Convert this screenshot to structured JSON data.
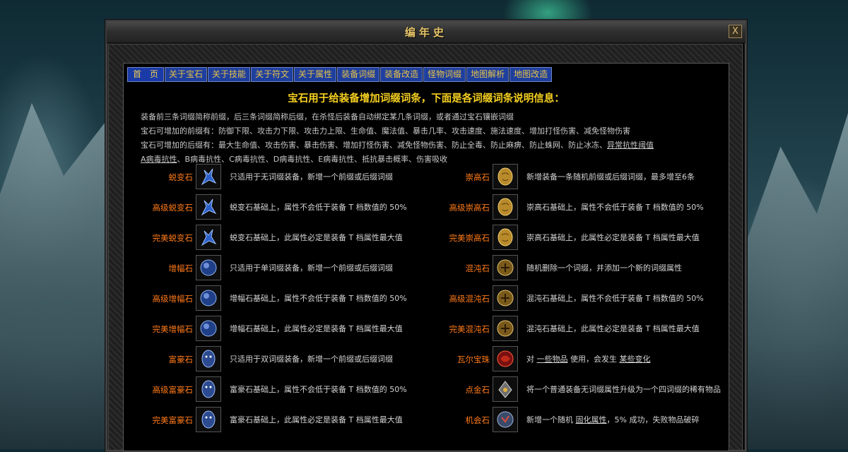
{
  "window": {
    "title": "编年史",
    "close_glyph": "X"
  },
  "tabs": [
    {
      "label": "首　页",
      "active": true
    },
    {
      "label": "关于宝石"
    },
    {
      "label": "关于技能"
    },
    {
      "label": "关于符文"
    },
    {
      "label": "关于属性"
    },
    {
      "label": "装备词缀"
    },
    {
      "label": "装备改造"
    },
    {
      "label": "怪物词缀"
    },
    {
      "label": "地图解析"
    },
    {
      "label": "地图改造"
    }
  ],
  "headline": "宝石用于给装备增加词缀词条，下面是各词缀词条说明信息：",
  "intro": {
    "line1": "装备前三条词缀简称前缀，后三条词缀简称后缀，在杀怪后装备自动绑定某几条词缀，或者通过宝石镶嵌词缀",
    "line2": "宝石可增加的前缀有：防御下限、攻击力下限、攻击力上限、生命值、魔法值、暴击几率、攻击速度、施法速度、增加打怪伤害、减免怪物伤害",
    "line3_a": "宝石可增加的后缀有：最大生命值、攻击伤害、暴击伤害、增加打怪伤害、减免怪物伤害、防止全毒、防止麻痹、防止蛛网、防止冰冻、",
    "line3_b": "异常抗性阈值",
    "line4_a": "A病毒抗性",
    "line4_b": "、B病毒抗性、C病毒抗性、D病毒抗性、E病毒抗性、抵抗暴击概率、伤害吸收"
  },
  "gems_left": [
    {
      "name": "蜕变石",
      "icon": "transmute-icon",
      "desc": "只适用于无词缀装备，新增一个前缀或后缀词缀"
    },
    {
      "name": "高级蜕变石",
      "icon": "transmute-icon",
      "desc": "蜕变石基础上，属性不会低于装备 T 档数值的 50%"
    },
    {
      "name": "完美蜕变石",
      "icon": "transmute-icon",
      "desc": "蜕变石基础上，此属性必定是装备 T 档属性最大值"
    },
    {
      "name": "增幅石",
      "icon": "augment-icon",
      "desc": "只适用于单词缀装备，新增一个前缀或后缀词缀"
    },
    {
      "name": "高级增幅石",
      "icon": "augment-icon",
      "desc": "增幅石基础上，属性不会低于装备 T 档数值的 50%"
    },
    {
      "name": "完美增幅石",
      "icon": "augment-icon",
      "desc": "增幅石基础上，此属性必定是装备 T 档属性最大值"
    },
    {
      "name": "富豪石",
      "icon": "regal-icon",
      "desc": "只适用于双词缀装备，新增一个前缀或后缀词缀"
    },
    {
      "name": "高级富豪石",
      "icon": "regal-icon",
      "desc": "富豪石基础上，属性不会低于装备 T 档数值的 50%"
    },
    {
      "name": "完美富豪石",
      "icon": "regal-icon",
      "desc": "富豪石基础上，此属性必定是装备 T 档属性最大值"
    }
  ],
  "gems_right": [
    {
      "name": "崇高石",
      "icon": "exalted-icon",
      "desc": "新增装备一条随机前缀或后缀词缀，最多增至6条"
    },
    {
      "name": "高级崇高石",
      "icon": "exalted-icon",
      "desc": "崇高石基础上，属性不会低于装备 T 档数值的 50%"
    },
    {
      "name": "完美崇高石",
      "icon": "exalted-icon",
      "desc": "崇高石基础上，此属性必定是装备 T 档属性最大值"
    },
    {
      "name": "混沌石",
      "icon": "chaos-icon",
      "desc": "随机删除一个词缀，并添加一个新的词缀属性"
    },
    {
      "name": "高级混沌石",
      "icon": "chaos-icon",
      "desc": "混沌石基础上，属性不会低于装备 T 档数值的 50%"
    },
    {
      "name": "完美混沌石",
      "icon": "chaos-icon",
      "desc": "混沌石基础上，此属性必定是装备 T 档属性最大值"
    },
    {
      "name": "瓦尔宝珠",
      "icon": "vaal-orb-icon",
      "desc_a": "对 ",
      "desc_u1": "一些物品",
      "desc_b": " 使用，会发生 ",
      "desc_u2": "某些变化"
    },
    {
      "name": "点金石",
      "icon": "alchemy-icon",
      "desc": "将一个普通装备无词缀属性升级为一个四词缀的稀有物品"
    },
    {
      "name": "机会石",
      "icon": "chance-icon",
      "desc_a": "新增一个随机 ",
      "desc_u1": "固化属性",
      "desc_b": "，5% 成功，失败物品破碎"
    }
  ],
  "colors": {
    "tab_bg": "#1f3f9e",
    "tab_text": "#e6c24a",
    "headline": "#f5d020",
    "gem_name": "#ff7a18",
    "body_text": "#d4d4d4"
  }
}
